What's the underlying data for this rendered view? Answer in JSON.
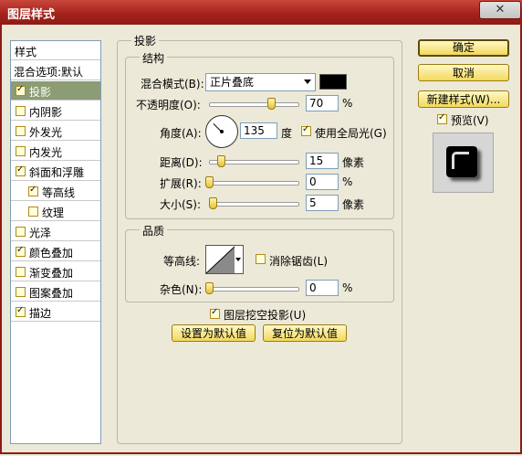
{
  "window": {
    "title": "图层样式"
  },
  "left_panel": {
    "header": "样式",
    "items": [
      {
        "label": "混合选项:默认",
        "checkbox": false,
        "checked": false,
        "indent": false,
        "selected": false
      },
      {
        "label": "投影",
        "checkbox": true,
        "checked": true,
        "indent": false,
        "selected": true
      },
      {
        "label": "内阴影",
        "checkbox": true,
        "checked": false,
        "indent": false,
        "selected": false
      },
      {
        "label": "外发光",
        "checkbox": true,
        "checked": false,
        "indent": false,
        "selected": false
      },
      {
        "label": "内发光",
        "checkbox": true,
        "checked": false,
        "indent": false,
        "selected": false
      },
      {
        "label": "斜面和浮雕",
        "checkbox": true,
        "checked": true,
        "indent": false,
        "selected": false
      },
      {
        "label": "等高线",
        "checkbox": true,
        "checked": true,
        "indent": true,
        "selected": false
      },
      {
        "label": "纹理",
        "checkbox": true,
        "checked": false,
        "indent": true,
        "selected": false
      },
      {
        "label": "光泽",
        "checkbox": true,
        "checked": false,
        "indent": false,
        "selected": false
      },
      {
        "label": "颜色叠加",
        "checkbox": true,
        "checked": true,
        "indent": false,
        "selected": false
      },
      {
        "label": "渐变叠加",
        "checkbox": true,
        "checked": false,
        "indent": false,
        "selected": false
      },
      {
        "label": "图案叠加",
        "checkbox": true,
        "checked": false,
        "indent": false,
        "selected": false
      },
      {
        "label": "描边",
        "checkbox": true,
        "checked": true,
        "indent": false,
        "selected": false
      }
    ]
  },
  "shadow": {
    "title": "投影",
    "structure": {
      "title": "结构",
      "blend_mode_label": "混合模式(B):",
      "blend_mode_value": "正片叠底",
      "blend_color": "#000000",
      "opacity_label": "不透明度(O):",
      "opacity_value": "70",
      "opacity_unit": "%",
      "opacity_level": 0.7,
      "angle_label": "角度(A):",
      "angle_value": "135",
      "angle_unit": "度",
      "global_light_label": "使用全局光(G)",
      "global_light_checked": true,
      "distance_label": "距离(D):",
      "distance_value": "15",
      "distance_unit": "像素",
      "spread_label": "扩展(R):",
      "spread_value": "0",
      "spread_unit": "%",
      "size_label": "大小(S):",
      "size_value": "5",
      "size_unit": "像素"
    },
    "quality": {
      "title": "品质",
      "contour_label": "等高线:",
      "anti_alias_label": "消除锯齿(L)",
      "anti_alias_checked": false,
      "noise_label": "杂色(N):",
      "noise_value": "0",
      "noise_unit": "%"
    },
    "knockout_label": "图层挖空投影(U)",
    "knockout_checked": true,
    "make_default_label": "设置为默认值",
    "reset_default_label": "复位为默认值"
  },
  "right": {
    "ok_label": "确定",
    "cancel_label": "取消",
    "new_style_label": "新建样式(W)...",
    "preview_label": "预览(V)",
    "preview_checked": true
  },
  "icons": {
    "close": "close-icon",
    "dropdown": "chevron-down-icon"
  },
  "colors": {
    "title_bar": "#a6231c",
    "selected_item": "#8c9c74",
    "button": "#f2d95d"
  }
}
